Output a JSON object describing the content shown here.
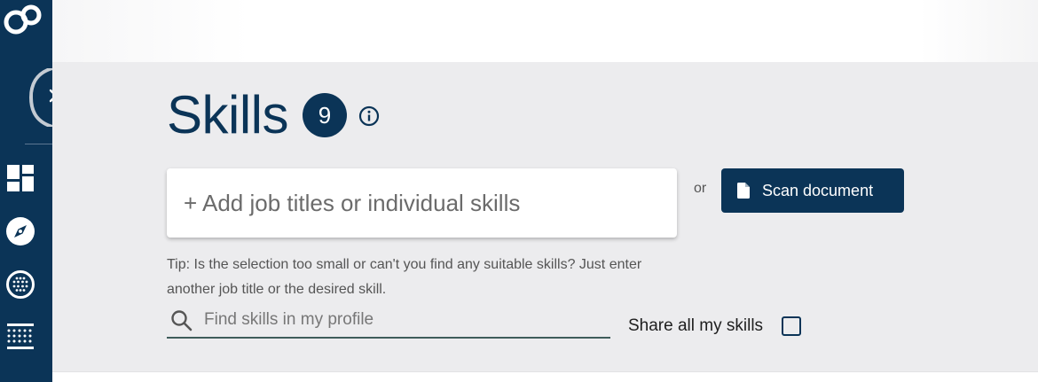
{
  "sidebar": {
    "logo_icon": "logo-rings-icon",
    "toggle_icon": "chevron-right-icon",
    "items": [
      {
        "icon": "dashboard-icon"
      },
      {
        "icon": "compass-icon"
      },
      {
        "icon": "globe-dots-icon"
      },
      {
        "icon": "grid-list-icon"
      }
    ]
  },
  "skills": {
    "title": "Skills",
    "count": "9",
    "info_icon": "info-icon"
  },
  "add": {
    "placeholder": "+ Add job titles or individual skills",
    "or": "or",
    "scan_label": "Scan document",
    "scan_icon": "document-icon"
  },
  "tip": "Tip: Is the selection too small or can't you find any suitable skills? Just enter another job title or the desired skill.",
  "search": {
    "placeholder": "Find skills in my profile",
    "icon": "search-icon"
  },
  "share": {
    "label": "Share all my skills",
    "checked": false
  },
  "colors": {
    "primary": "#0b3457",
    "background": "#ececee",
    "search_underline": "#3e5c5a"
  }
}
